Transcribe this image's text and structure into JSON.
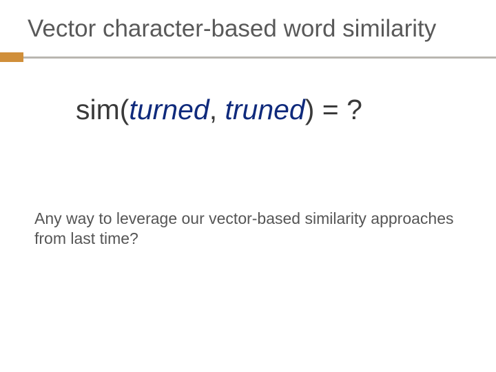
{
  "title": "Vector character-based word similarity",
  "formula": {
    "fn": "sim",
    "open": "(",
    "arg1": "turned",
    "comma": ", ",
    "arg2": "truned",
    "close": ")",
    "after": " = ?"
  },
  "body": "Any way to leverage our vector-based similarity approaches from last time?"
}
